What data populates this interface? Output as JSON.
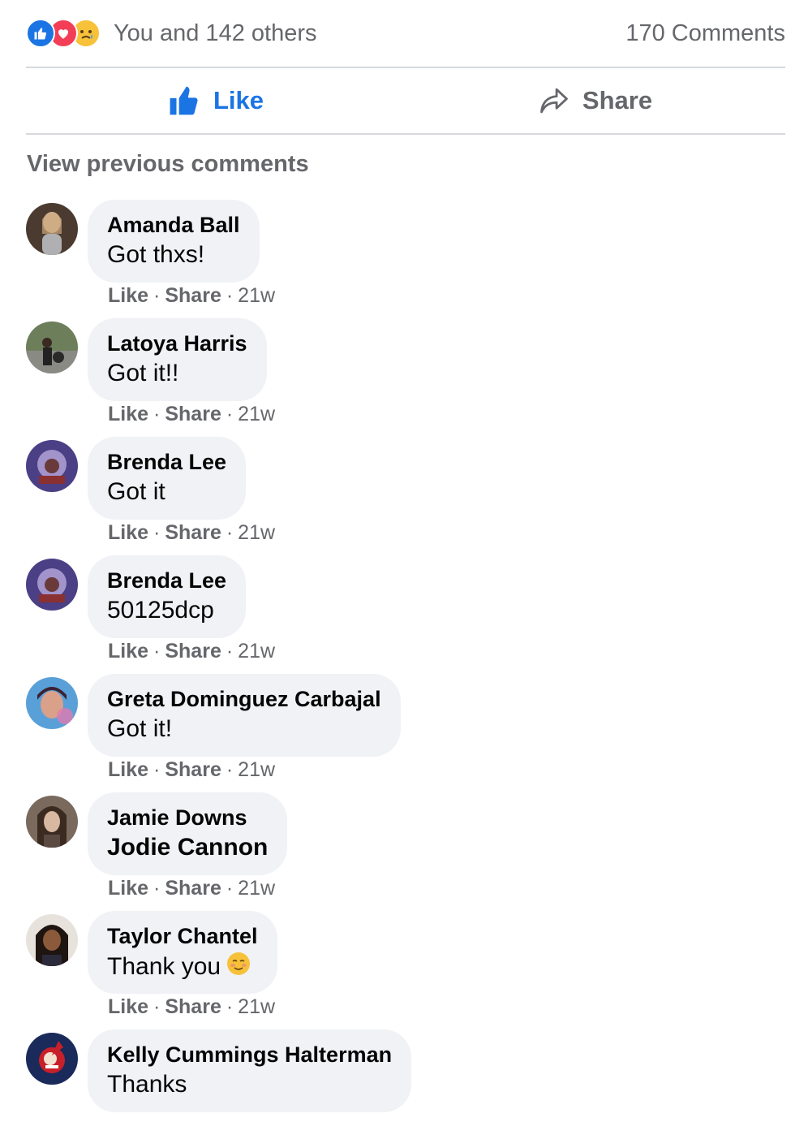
{
  "reactions": {
    "icons": [
      "like-reaction",
      "love-reaction",
      "sad-reaction"
    ],
    "summary": "You and 142 others",
    "comments_count": "170 Comments"
  },
  "actions": {
    "like_label": "Like",
    "share_label": "Share"
  },
  "view_previous_label": "View previous comments",
  "comment_actions": {
    "like": "Like",
    "share": "Share",
    "separator": "·"
  },
  "comments": [
    {
      "author": "Amanda Ball",
      "text": "Got thxs!",
      "time": "21w"
    },
    {
      "author": "Latoya Harris",
      "text": "Got it!!",
      "time": "21w"
    },
    {
      "author": "Brenda Lee",
      "text": "Got it",
      "time": "21w"
    },
    {
      "author": "Brenda Lee",
      "text": "50125dcp",
      "time": "21w"
    },
    {
      "author": "Greta Dominguez Carbajal",
      "text": "Got it!",
      "time": "21w"
    },
    {
      "author": "Jamie Downs",
      "text": "Jodie Cannon",
      "time": "21w"
    },
    {
      "author": "Taylor Chantel",
      "text": "Thank you",
      "time": "21w"
    },
    {
      "author": "Kelly Cummings Halterman",
      "text": "Thanks",
      "time": ""
    }
  ],
  "colors": {
    "accent": "#1b74e4",
    "bubble": "#f0f2f5",
    "secondary_text": "#65676b"
  }
}
